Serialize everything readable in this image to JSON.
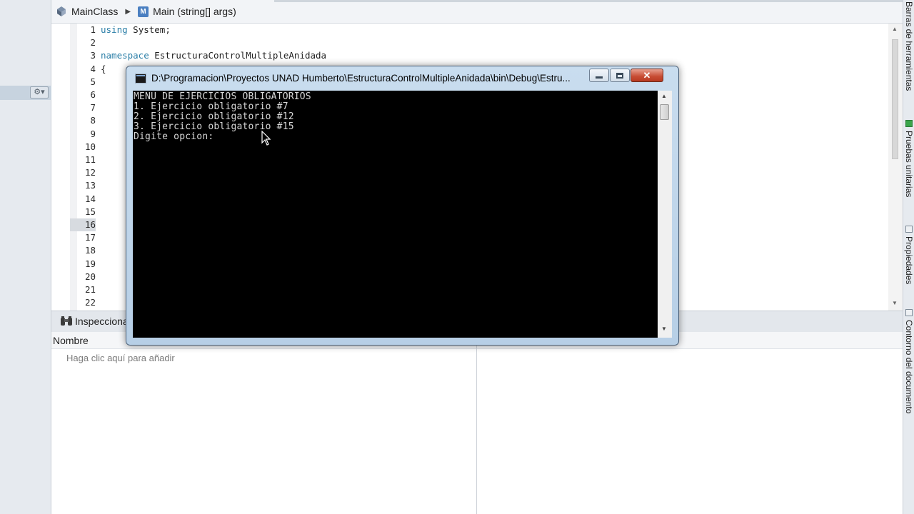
{
  "breadcrumb": {
    "class_name": "MainClass",
    "separator": "▶",
    "member_icon_letter": "M",
    "method_name": "Main (string[] args)"
  },
  "editor": {
    "line_numbers": [
      "1",
      "2",
      "3",
      "4",
      "5",
      "6",
      "7",
      "8",
      "9",
      "10",
      "11",
      "12",
      "13",
      "14",
      "15",
      "16",
      "17",
      "18",
      "19",
      "20",
      "21",
      "22"
    ],
    "highlighted_line": "16",
    "code": {
      "line1_kw": "using",
      "line1_rest": " System;",
      "line3_kw": "namespace",
      "line3_rest": " EstructuraControlMultipleAnidada",
      "line4": "{"
    }
  },
  "watch_panel": {
    "title": "Inspecciona",
    "column_name": "Nombre",
    "placeholder": "Haga clic aquí para añadir"
  },
  "right_tabs": {
    "toolbox": "Barras de herramientas",
    "unit_tests": "Pruebas unitarias",
    "properties": "Propiedades",
    "document_outline": "Contorno del documento"
  },
  "console": {
    "title": "D:\\Programacion\\Proyectos UNAD Humberto\\EstructuraControlMultipleAnidada\\bin\\Debug\\Estru...",
    "minimize_label": "▭",
    "maximize_label": "▢",
    "close_label": "✕",
    "output": "MENU DE EJERCICIOS OBLIGATORIOS\n1. Ejercicio obligatorio #7\n2. Ejercicio obligatorio #12\n3. Ejercicio obligatorio #15\nDigite opcion:"
  },
  "colors": {
    "keyword": "#2a7ea7",
    "console_bg": "#000000",
    "console_fg": "#d8d8d8",
    "close_button": "#c74b32"
  },
  "icons": {
    "class_icon": "class-icon",
    "method_icon": "method-icon",
    "watch_icon": "binoculars-icon",
    "gear_icon": "gear-icon"
  }
}
